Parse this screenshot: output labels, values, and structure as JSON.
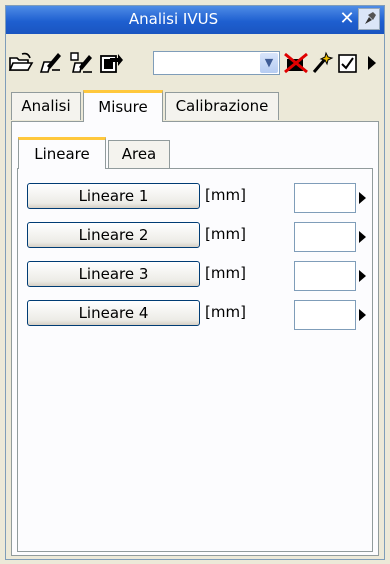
{
  "window": {
    "title": "Analisi IVUS",
    "close_glyph": "✕"
  },
  "toolbar": {
    "icons": [
      "open-folder-icon",
      "edit-icon",
      "edit-multi-icon",
      "export-icon",
      "delete-icon",
      "wand-icon",
      "checkbox-icon",
      "overflow-arrow-icon"
    ],
    "combo_value": ""
  },
  "tabs": [
    {
      "label": "Analisi",
      "active": false
    },
    {
      "label": "Misure",
      "active": true
    },
    {
      "label": "Calibrazione",
      "active": false
    }
  ],
  "subtabs": [
    {
      "label": "Lineare",
      "active": true
    },
    {
      "label": "Area",
      "active": false
    }
  ],
  "measurements": [
    {
      "label": "Lineare 1",
      "unit": "[mm]",
      "value": ""
    },
    {
      "label": "Lineare 2",
      "unit": "[mm]",
      "value": ""
    },
    {
      "label": "Lineare 3",
      "unit": "[mm]",
      "value": ""
    },
    {
      "label": "Lineare 4",
      "unit": "[mm]",
      "value": ""
    }
  ],
  "colors": {
    "titlebar": "#1e5fd0",
    "active_tab_accent": "#ffc83c",
    "button_border": "#003c74"
  }
}
